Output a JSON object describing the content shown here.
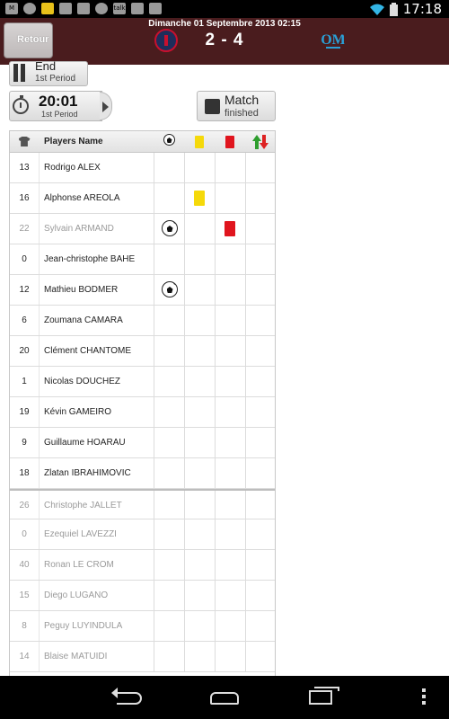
{
  "status_bar": {
    "time": "17:18",
    "left_icons": [
      "gmail-icon",
      "chrome-icon",
      "app-icon",
      "app-icon",
      "app-icon",
      "app-icon",
      "talk-icon",
      "download-icon",
      "shop-icon"
    ],
    "talk_label": "talk"
  },
  "header": {
    "date": "Dimanche 01 Septembre 2013 02:15",
    "back_label": "Retour",
    "score": "2 - 4",
    "home_logo": "psg-logo-icon",
    "away_logo": "om-logo-icon",
    "colors": {
      "header_bg": "#4a1c1e",
      "away_logo": "#2a9fd6"
    }
  },
  "period": {
    "state": "End",
    "sub": "1st Period"
  },
  "timer": {
    "value": "20:01",
    "sub": "1st Period"
  },
  "match": {
    "state": "Match",
    "sub": "finished"
  },
  "table": {
    "headers": {
      "number_icon": "shirt-icon",
      "name": "Players Name",
      "goal_icon": "ball-icon",
      "yellow_icon": "yellow-card-icon",
      "red_icon": "red-card-icon",
      "subs_icon": "substitution-icon"
    },
    "rows": [
      {
        "number": "13",
        "name": "Rodrigo ALEX",
        "goal": false,
        "yellow": false,
        "red": false,
        "dim": false,
        "sep": false
      },
      {
        "number": "16",
        "name": "Alphonse AREOLA",
        "goal": false,
        "yellow": true,
        "red": false,
        "dim": false,
        "sep": false
      },
      {
        "number": "22",
        "name": "Sylvain ARMAND",
        "goal": true,
        "yellow": false,
        "red": true,
        "dim": true,
        "sep": false
      },
      {
        "number": "0",
        "name": "Jean-christophe BAHE",
        "goal": false,
        "yellow": false,
        "red": false,
        "dim": false,
        "sep": false
      },
      {
        "number": "12",
        "name": "Mathieu BODMER",
        "goal": true,
        "yellow": false,
        "red": false,
        "dim": false,
        "sep": false
      },
      {
        "number": "6",
        "name": "Zoumana CAMARA",
        "goal": false,
        "yellow": false,
        "red": false,
        "dim": false,
        "sep": false
      },
      {
        "number": "20",
        "name": "Clément CHANTOME",
        "goal": false,
        "yellow": false,
        "red": false,
        "dim": false,
        "sep": false
      },
      {
        "number": "1",
        "name": "Nicolas DOUCHEZ",
        "goal": false,
        "yellow": false,
        "red": false,
        "dim": false,
        "sep": false
      },
      {
        "number": "19",
        "name": "Kévin GAMEIRO",
        "goal": false,
        "yellow": false,
        "red": false,
        "dim": false,
        "sep": false
      },
      {
        "number": "9",
        "name": "Guillaume HOARAU",
        "goal": false,
        "yellow": false,
        "red": false,
        "dim": false,
        "sep": false
      },
      {
        "number": "18",
        "name": "Zlatan IBRAHIMOVIC",
        "goal": false,
        "yellow": false,
        "red": false,
        "dim": false,
        "sep": false
      },
      {
        "number": "26",
        "name": "Christophe JALLET",
        "goal": false,
        "yellow": false,
        "red": false,
        "dim": true,
        "sep": true
      },
      {
        "number": "0",
        "name": "Ezequiel LAVEZZI",
        "goal": false,
        "yellow": false,
        "red": false,
        "dim": true,
        "sep": false
      },
      {
        "number": "40",
        "name": "Ronan LE CROM",
        "goal": false,
        "yellow": false,
        "red": false,
        "dim": true,
        "sep": false
      },
      {
        "number": "15",
        "name": "Diego LUGANO",
        "goal": false,
        "yellow": false,
        "red": false,
        "dim": true,
        "sep": false
      },
      {
        "number": "8",
        "name": "Peguy LUYINDULA",
        "goal": false,
        "yellow": false,
        "red": false,
        "dim": true,
        "sep": false
      },
      {
        "number": "14",
        "name": "Blaise MATUIDI",
        "goal": false,
        "yellow": false,
        "red": false,
        "dim": true,
        "sep": false
      }
    ]
  },
  "nav_bar": {
    "buttons": [
      "back-icon",
      "home-icon",
      "recent-apps-icon",
      "menu-icon"
    ]
  }
}
